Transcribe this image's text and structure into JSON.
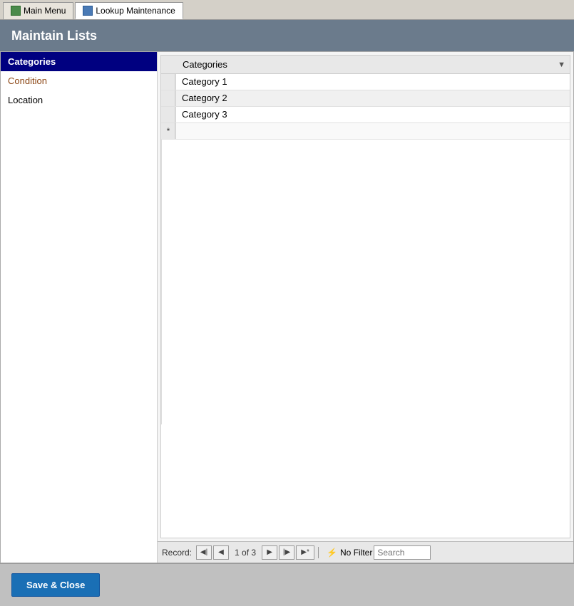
{
  "tabs": [
    {
      "id": "main-menu",
      "label": "Main Menu",
      "active": false,
      "icon": "grid-icon"
    },
    {
      "id": "lookup-maintenance",
      "label": "Lookup Maintenance",
      "active": true,
      "icon": "table-icon"
    }
  ],
  "header": {
    "title": "Maintain Lists"
  },
  "sidebar": {
    "items": [
      {
        "id": "categories",
        "label": "Categories",
        "active": true,
        "style": "active"
      },
      {
        "id": "condition",
        "label": "Condition",
        "active": false,
        "style": "condition"
      },
      {
        "id": "location",
        "label": "Location",
        "active": false,
        "style": "location"
      }
    ]
  },
  "grid": {
    "column_header": "Categories",
    "rows": [
      {
        "indicator": "",
        "value": "Category 1"
      },
      {
        "indicator": "",
        "value": "Category 2"
      },
      {
        "indicator": "",
        "value": "Category 3"
      },
      {
        "indicator": "*",
        "value": ""
      }
    ]
  },
  "navigation": {
    "record_label": "Record:",
    "current_record": "1 of 3",
    "filter_label": "No Filter",
    "search_placeholder": "Search",
    "buttons": [
      {
        "id": "first",
        "label": "◀|",
        "title": "First Record"
      },
      {
        "id": "prev",
        "label": "◀",
        "title": "Previous Record"
      },
      {
        "id": "next",
        "label": "▶",
        "title": "Next Record"
      },
      {
        "id": "last",
        "label": "|▶",
        "title": "Last Record"
      },
      {
        "id": "new",
        "label": "▶*",
        "title": "New Record"
      }
    ]
  },
  "footer": {
    "save_close_label": "Save & Close"
  }
}
